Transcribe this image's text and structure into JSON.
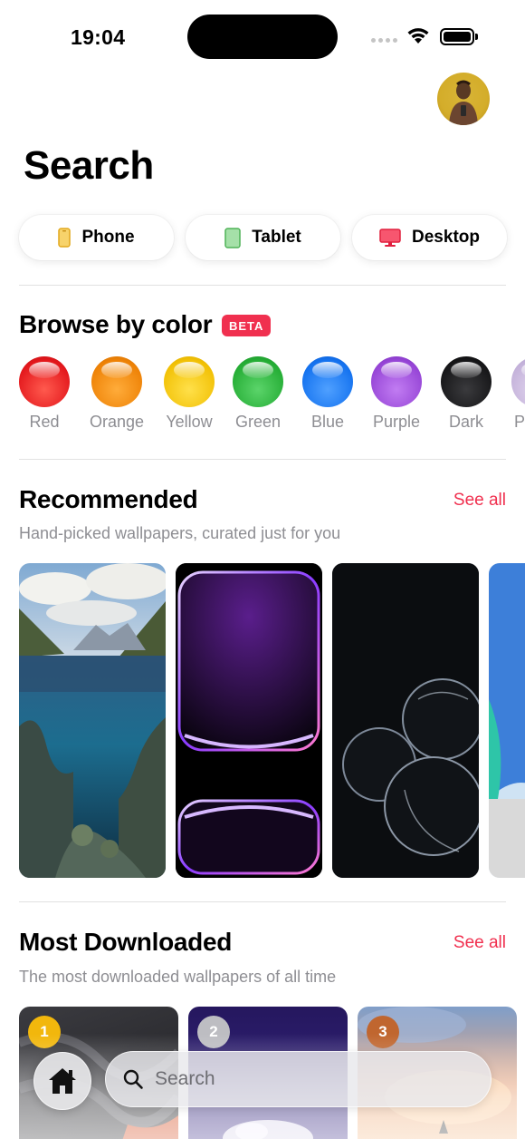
{
  "status_bar": {
    "time": "19:04"
  },
  "header": {
    "title": "Search"
  },
  "device_filters": [
    {
      "label": "Phone",
      "icon": "phone-icon"
    },
    {
      "label": "Tablet",
      "icon": "tablet-icon"
    },
    {
      "label": "Desktop",
      "icon": "desktop-icon"
    }
  ],
  "browse_by_color": {
    "title": "Browse by color",
    "badge": "BETA",
    "colors": [
      {
        "label": "Red",
        "hex": "#f0262b"
      },
      {
        "label": "Orange",
        "hex": "#f28a0a"
      },
      {
        "label": "Yellow",
        "hex": "#f5c30d"
      },
      {
        "label": "Green",
        "hex": "#2bb33a"
      },
      {
        "label": "Blue",
        "hex": "#1778f2"
      },
      {
        "label": "Purple",
        "hex": "#9b49d9"
      },
      {
        "label": "Dark",
        "hex": "#1b1b1d"
      },
      {
        "label": "Pastel",
        "hex": "#c9b8dc"
      }
    ]
  },
  "recommended": {
    "title": "Recommended",
    "see_all": "See all",
    "subtitle": "Hand-picked wallpapers, curated just for you"
  },
  "most_downloaded": {
    "title": "Most Downloaded",
    "see_all": "See all",
    "subtitle": "The most downloaded wallpapers of all time",
    "ranks": [
      "1",
      "2",
      "3"
    ]
  },
  "bottom_bar": {
    "search_placeholder": "Search"
  },
  "colors": {
    "accent": "#f0304f",
    "secondary_text": "#8e8e93"
  }
}
